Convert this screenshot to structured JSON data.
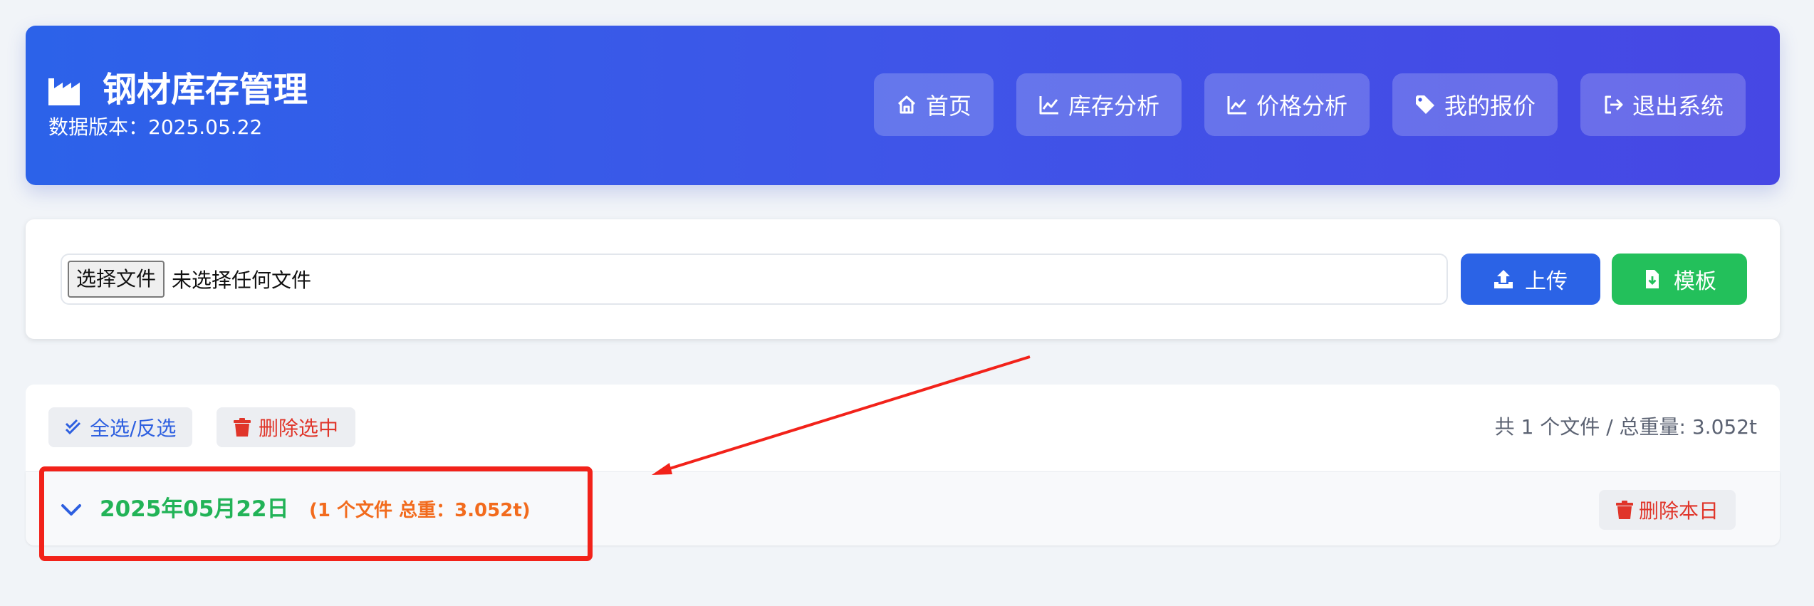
{
  "header": {
    "title": "钢材库存管理",
    "version": "数据版本：2025.05.22",
    "icon": "factory-icon",
    "nav": [
      {
        "label": "首页",
        "icon": "home-icon"
      },
      {
        "label": "库存分析",
        "icon": "line-chart-icon"
      },
      {
        "label": "价格分析",
        "icon": "line-chart-icon"
      },
      {
        "label": "我的报价",
        "icon": "tag-icon"
      },
      {
        "label": "退出系统",
        "icon": "sign-out-icon"
      }
    ]
  },
  "upload": {
    "choose_label": "选择文件",
    "file_status": "未选择任何文件",
    "upload_label": "上传",
    "template_label": "模板"
  },
  "list": {
    "select_all_label": "全选/反选",
    "delete_selected_label": "删除选中",
    "summary": "共 1 个文件 / 总重量: 3.052t",
    "groups": [
      {
        "date": "2025年05月22日",
        "meta": "(1 个文件 总重：3.052t)",
        "delete_label": "删除本日"
      }
    ]
  },
  "colors": {
    "header_gradient_start": "#2c62e9",
    "header_gradient_end": "#4647e4",
    "upload_button": "#2b63e6",
    "template_button": "#23c05b",
    "danger": "#e0352a",
    "date_green": "#22b357",
    "meta_orange": "#f26b1d",
    "annotation_red": "#f2221a"
  }
}
